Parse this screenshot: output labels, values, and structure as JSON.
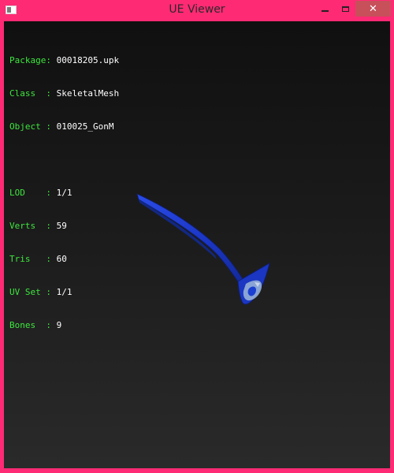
{
  "window": {
    "title": "UE Viewer",
    "close_glyph": "✕",
    "icons": {
      "app": "app-icon",
      "minimize": "minimize-icon",
      "maximize": "maximize-icon",
      "close": "close-icon"
    },
    "colors": {
      "frame": "#ff2a74",
      "close_button": "#c7505a"
    }
  },
  "info": {
    "package": {
      "label": "Package:",
      "value": "00018205.upk"
    },
    "class": {
      "label": "Class  :",
      "value": "SkeletalMesh"
    },
    "object": {
      "label": "Object :",
      "value": "010025_GonM"
    },
    "lod": {
      "label": "LOD    :",
      "value": "1/1"
    },
    "verts": {
      "label": "Verts  :",
      "value": "59"
    },
    "tris": {
      "label": "Tris   :",
      "value": "60"
    },
    "uvset": {
      "label": "UV Set :",
      "value": "1/1"
    },
    "bones": {
      "label": "Bones  :",
      "value": "9"
    },
    "colors": {
      "label": "#3ee63e",
      "value": "#ffffff"
    }
  },
  "mesh": {
    "name": "skeletal-mesh",
    "color": "#1f3fd0"
  }
}
